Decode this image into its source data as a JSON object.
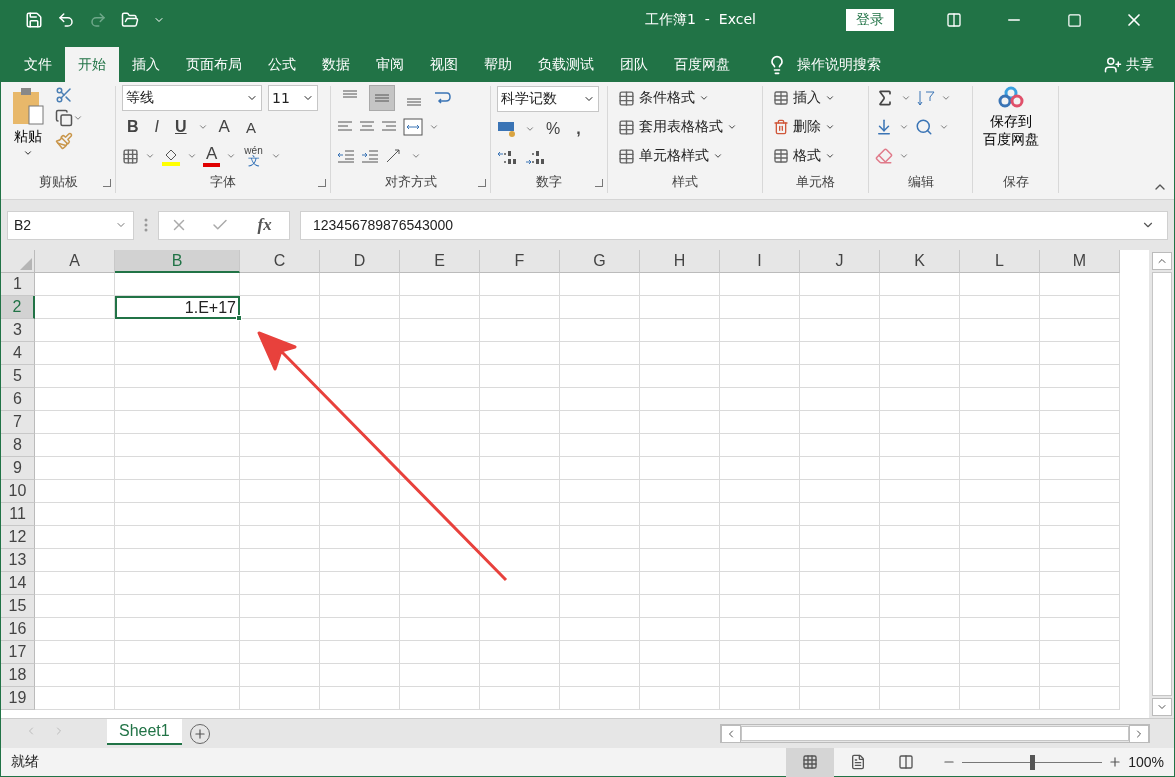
{
  "window": {
    "title": "工作簿1  -  Excel",
    "login_button": "登录"
  },
  "menu_tabs": [
    {
      "label": "文件",
      "selected": false
    },
    {
      "label": "开始",
      "selected": true
    },
    {
      "label": "插入",
      "selected": false
    },
    {
      "label": "页面布局",
      "selected": false
    },
    {
      "label": "公式",
      "selected": false
    },
    {
      "label": "数据",
      "selected": false
    },
    {
      "label": "审阅",
      "selected": false
    },
    {
      "label": "视图",
      "selected": false
    },
    {
      "label": "帮助",
      "selected": false
    },
    {
      "label": "负载测试",
      "selected": false
    },
    {
      "label": "团队",
      "selected": false
    },
    {
      "label": "百度网盘",
      "selected": false
    }
  ],
  "tell_me": "操作说明搜索",
  "share": "共享",
  "ribbon": {
    "clipboard": {
      "label": "剪贴板",
      "paste": "粘贴"
    },
    "font": {
      "label": "字体",
      "font_name": "等线",
      "font_size": "11",
      "style_buttons": [
        "B",
        "I",
        "U"
      ],
      "size_buttons": [
        "A",
        "A"
      ],
      "font_color_button": "A",
      "phonetic_pinyin": "wén",
      "phonetic_char": "文"
    },
    "alignment": {
      "label": "对齐方式",
      "vertical_align": [
        {
          "selected": false
        },
        {
          "selected": true
        },
        {
          "selected": false
        }
      ]
    },
    "number": {
      "label": "数字",
      "format": "科学记数",
      "percent": "%",
      "comma": ","
    },
    "styles": {
      "label": "样式",
      "items": [
        "条件格式",
        "套用表格格式",
        "单元格样式"
      ]
    },
    "cells": {
      "label": "单元格",
      "items": [
        "插入",
        "删除",
        "格式"
      ]
    },
    "editing": {
      "label": "编辑"
    },
    "save": {
      "label": "保存",
      "button_lines": [
        "保存到",
        "百度网盘"
      ]
    }
  },
  "formula_bar": {
    "name_box": "B2",
    "function_label": "fx",
    "formula": "123456789876543000"
  },
  "grid": {
    "active_cell_value": "1.E+17",
    "columns": [
      {
        "label": "A",
        "selected": false
      },
      {
        "label": "B",
        "selected": true
      },
      {
        "label": "C",
        "selected": false
      },
      {
        "label": "D",
        "selected": false
      },
      {
        "label": "E",
        "selected": false
      },
      {
        "label": "F",
        "selected": false
      },
      {
        "label": "G",
        "selected": false
      },
      {
        "label": "H",
        "selected": false
      },
      {
        "label": "I",
        "selected": false
      },
      {
        "label": "J",
        "selected": false
      },
      {
        "label": "K",
        "selected": false
      },
      {
        "label": "L",
        "selected": false
      },
      {
        "label": "M",
        "selected": false
      }
    ],
    "rows": [
      {
        "label": "1",
        "selected": false
      },
      {
        "label": "2",
        "selected": true
      },
      {
        "label": "3",
        "selected": false
      },
      {
        "label": "4",
        "selected": false
      },
      {
        "label": "5",
        "selected": false
      },
      {
        "label": "6",
        "selected": false
      },
      {
        "label": "7",
        "selected": false
      },
      {
        "label": "8",
        "selected": false
      },
      {
        "label": "9",
        "selected": false
      },
      {
        "label": "10",
        "selected": false
      },
      {
        "label": "11",
        "selected": false
      },
      {
        "label": "12",
        "selected": false
      },
      {
        "label": "13",
        "selected": false
      },
      {
        "label": "14",
        "selected": false
      },
      {
        "label": "15",
        "selected": false
      },
      {
        "label": "16",
        "selected": false
      },
      {
        "label": "17",
        "selected": false
      },
      {
        "label": "18",
        "selected": false
      },
      {
        "label": "19",
        "selected": false
      }
    ]
  },
  "sheet_tabs": [
    {
      "label": "Sheet1",
      "selected": true
    }
  ],
  "status_bar": {
    "status": "就绪",
    "views": [
      {
        "selected": true
      },
      {
        "selected": false
      },
      {
        "selected": false
      }
    ],
    "zoom": {
      "level": 0.5
    },
    "zoom_reading": "100%"
  }
}
